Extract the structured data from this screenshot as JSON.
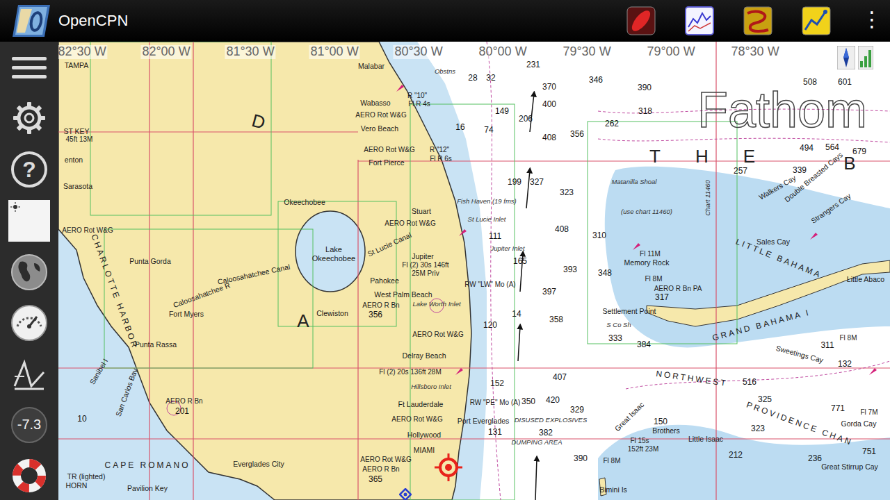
{
  "window": {
    "title": "OpenCPN",
    "menu_glyph": "⋮"
  },
  "sidebar": {
    "help_glyph": "?",
    "zoom_reading": "-7.3"
  },
  "map": {
    "longitudes": [
      "82°30 W",
      "82°00 W",
      "81°30 W",
      "81°00 W",
      "80°30 W",
      "80°00 W",
      "79°30 W",
      "79°00 W",
      "78°30 W"
    ],
    "labels": [
      {
        "text": "TAMPA",
        "kind": "place"
      },
      {
        "text": "ST KEY",
        "kind": "place"
      },
      {
        "text": "45ft 13M",
        "kind": "light"
      },
      {
        "text": "enton",
        "kind": "place"
      },
      {
        "text": "Sarasota",
        "kind": "place"
      },
      {
        "text": "AERO Rot W&G",
        "kind": "nav"
      },
      {
        "text": "CHARLOTTE HARBOR",
        "kind": "caps"
      },
      {
        "text": "Punta Gorda",
        "kind": "place"
      },
      {
        "text": "Caloosahatchee R",
        "kind": "place"
      },
      {
        "text": "Caloosahatchee Canal",
        "kind": "place"
      },
      {
        "text": "Fort Myers",
        "kind": "place"
      },
      {
        "text": "Punta Rassa",
        "kind": "place"
      },
      {
        "text": "Sanibel I",
        "kind": "place"
      },
      {
        "text": "San Carlos Bay",
        "kind": "place"
      },
      {
        "text": "AERO R Bn",
        "kind": "nav"
      },
      {
        "text": "201",
        "kind": "depth"
      },
      {
        "text": "10",
        "kind": "depth"
      },
      {
        "text": "CAPE ROMANO",
        "kind": "caps"
      },
      {
        "text": "Everglades City",
        "kind": "place"
      },
      {
        "text": "TR (lighted)",
        "kind": "place"
      },
      {
        "text": "HORN",
        "kind": "place"
      },
      {
        "text": "Pavilion Key",
        "kind": "place"
      },
      {
        "text": "D",
        "kind": "big"
      },
      {
        "text": "A",
        "kind": "big"
      },
      {
        "text": "Malabar",
        "kind": "place"
      },
      {
        "text": "Wabasso",
        "kind": "place"
      },
      {
        "text": "AERO Rot W&G",
        "kind": "nav"
      },
      {
        "text": "Vero Beach",
        "kind": "place"
      },
      {
        "text": "AERO Rot W&G",
        "kind": "nav"
      },
      {
        "text": "Fort Pierce",
        "kind": "place"
      },
      {
        "text": "R \"10\"",
        "kind": "light"
      },
      {
        "text": "Fl R 4s",
        "kind": "light"
      },
      {
        "text": "R \"12\"",
        "kind": "light"
      },
      {
        "text": "Fl R 6s",
        "kind": "light"
      },
      {
        "text": "Okeechobee",
        "kind": "place"
      },
      {
        "text": "Lake Okeechobee",
        "kind": "lake"
      },
      {
        "text": "St Lucie Canal",
        "kind": "place"
      },
      {
        "text": "Stuart",
        "kind": "place"
      },
      {
        "text": "AERO Rot W&G",
        "kind": "nav"
      },
      {
        "text": "Jupiter",
        "kind": "place"
      },
      {
        "text": "Fl (2) 30s 146ft",
        "kind": "light"
      },
      {
        "text": "25M Priv",
        "kind": "light"
      },
      {
        "text": "Pahokee",
        "kind": "place"
      },
      {
        "text": "Clewiston",
        "kind": "place"
      },
      {
        "text": "West Palm Beach",
        "kind": "place"
      },
      {
        "text": "Lake Worth Inlet",
        "kind": "area"
      },
      {
        "text": "AERO R Bn",
        "kind": "nav"
      },
      {
        "text": "356",
        "kind": "depth"
      },
      {
        "text": "AERO Rot W&G",
        "kind": "nav"
      },
      {
        "text": "Delray Beach",
        "kind": "place"
      },
      {
        "text": "Fl (2) 20s 136ft 28M",
        "kind": "light"
      },
      {
        "text": "Hillsboro Inlet",
        "kind": "area"
      },
      {
        "text": "Ft Lauderdale",
        "kind": "place"
      },
      {
        "text": "AERO Rot W&G",
        "kind": "nav"
      },
      {
        "text": "Hollywood",
        "kind": "place"
      },
      {
        "text": "AERO Rot W&G",
        "kind": "nav"
      },
      {
        "text": "AERO R Bn",
        "kind": "nav"
      },
      {
        "text": "365",
        "kind": "depth"
      },
      {
        "text": "MIAMI",
        "kind": "place"
      },
      {
        "text": "Port Everglades",
        "kind": "place"
      },
      {
        "text": "RW \"PE\" Mo (A)",
        "kind": "light"
      },
      {
        "text": "RW \"LW\" Mo (A)",
        "kind": "light"
      },
      {
        "text": "Fish Haven (19 fms)",
        "kind": "area"
      },
      {
        "text": "St Lucie Inlet",
        "kind": "area"
      },
      {
        "text": "Jupiter Inlet",
        "kind": "area"
      },
      {
        "text": "Obstns",
        "kind": "area"
      },
      {
        "text": "DISUSED EXPLOSIVES",
        "kind": "area"
      },
      {
        "text": "DUMPING AREA",
        "kind": "area"
      },
      {
        "text": "28",
        "kind": "depth"
      },
      {
        "text": "32",
        "kind": "depth"
      },
      {
        "text": "231",
        "kind": "depth"
      },
      {
        "text": "370",
        "kind": "depth"
      },
      {
        "text": "346",
        "kind": "depth"
      },
      {
        "text": "390",
        "kind": "depth"
      },
      {
        "text": "149",
        "kind": "depth"
      },
      {
        "text": "206",
        "kind": "depth"
      },
      {
        "text": "400",
        "kind": "depth"
      },
      {
        "text": "16",
        "kind": "depth"
      },
      {
        "text": "74",
        "kind": "depth"
      },
      {
        "text": "356",
        "kind": "depth"
      },
      {
        "text": "408",
        "kind": "depth"
      },
      {
        "text": "318",
        "kind": "depth"
      },
      {
        "text": "262",
        "kind": "depth"
      },
      {
        "text": "508",
        "kind": "depth"
      },
      {
        "text": "601",
        "kind": "depth"
      },
      {
        "text": "494",
        "kind": "depth"
      },
      {
        "text": "564",
        "kind": "depth"
      },
      {
        "text": "679",
        "kind": "depth"
      },
      {
        "text": "199",
        "kind": "depth"
      },
      {
        "text": "327",
        "kind": "depth"
      },
      {
        "text": "323",
        "kind": "depth"
      },
      {
        "text": "257",
        "kind": "depth"
      },
      {
        "text": "339",
        "kind": "depth"
      },
      {
        "text": "408",
        "kind": "depth"
      },
      {
        "text": "310",
        "kind": "depth"
      },
      {
        "text": "111",
        "kind": "depth"
      },
      {
        "text": "165",
        "kind": "depth"
      },
      {
        "text": "393",
        "kind": "depth"
      },
      {
        "text": "348",
        "kind": "depth"
      },
      {
        "text": "397",
        "kind": "depth"
      },
      {
        "text": "358",
        "kind": "depth"
      },
      {
        "text": "14",
        "kind": "depth"
      },
      {
        "text": "120",
        "kind": "depth"
      },
      {
        "text": "333",
        "kind": "depth"
      },
      {
        "text": "384",
        "kind": "depth"
      },
      {
        "text": "516",
        "kind": "depth"
      },
      {
        "text": "325",
        "kind": "depth"
      },
      {
        "text": "323",
        "kind": "depth"
      },
      {
        "text": "771",
        "kind": "depth"
      },
      {
        "text": "751",
        "kind": "depth"
      },
      {
        "text": "311",
        "kind": "depth"
      },
      {
        "text": "132",
        "kind": "depth"
      },
      {
        "text": "212",
        "kind": "depth"
      },
      {
        "text": "236",
        "kind": "depth"
      },
      {
        "text": "150",
        "kind": "depth"
      },
      {
        "text": "350",
        "kind": "depth"
      },
      {
        "text": "420",
        "kind": "depth"
      },
      {
        "text": "329",
        "kind": "depth"
      },
      {
        "text": "382",
        "kind": "depth"
      },
      {
        "text": "390",
        "kind": "depth"
      },
      {
        "text": "131",
        "kind": "depth"
      },
      {
        "text": "152",
        "kind": "depth"
      },
      {
        "text": "407",
        "kind": "depth"
      },
      {
        "text": "Fathom",
        "kind": "watermark"
      },
      {
        "text": "THE",
        "kind": "spaced"
      },
      {
        "text": "B",
        "kind": "big"
      },
      {
        "text": "Matanilla Shoal",
        "kind": "area"
      },
      {
        "text": "(use chart 11460)",
        "kind": "area"
      },
      {
        "text": "Chart 11460",
        "kind": "area"
      },
      {
        "text": "Walkers Cay",
        "kind": "place"
      },
      {
        "text": "Double Breasted Cays",
        "kind": "place"
      },
      {
        "text": "Strangers Cay",
        "kind": "place"
      },
      {
        "text": "Sales Cay",
        "kind": "place"
      },
      {
        "text": "LITTLE BAHAMA",
        "kind": "caps"
      },
      {
        "text": "Little Abaco",
        "kind": "place"
      },
      {
        "text": "Fl 11M",
        "kind": "light"
      },
      {
        "text": "Memory Rock",
        "kind": "place"
      },
      {
        "text": "Fl 8M",
        "kind": "light"
      },
      {
        "text": "AERO R Bn PA",
        "kind": "nav"
      },
      {
        "text": "317",
        "kind": "depth"
      },
      {
        "text": "Settlement Point",
        "kind": "place"
      },
      {
        "text": "S Co Sh",
        "kind": "area"
      },
      {
        "text": "GRAND BAHAMA I",
        "kind": "caps"
      },
      {
        "text": "Sweetings Cay",
        "kind": "place"
      },
      {
        "text": "NORTHWEST",
        "kind": "caps"
      },
      {
        "text": "PROVIDENCE CHAN",
        "kind": "caps"
      },
      {
        "text": "Great Isaac",
        "kind": "place"
      },
      {
        "text": "Brothers",
        "kind": "place"
      },
      {
        "text": "Little Isaac",
        "kind": "place"
      },
      {
        "text": "Fl 15s",
        "kind": "light"
      },
      {
        "text": "152ft 23M",
        "kind": "light"
      },
      {
        "text": "Fl 8M",
        "kind": "light"
      },
      {
        "text": "Bimini Is",
        "kind": "place"
      },
      {
        "text": "Gorda Cay",
        "kind": "place"
      },
      {
        "text": "Great Stirrup Cay",
        "kind": "place"
      },
      {
        "text": "Fl 7M",
        "kind": "light"
      },
      {
        "text": "Fl 8M",
        "kind": "light"
      }
    ]
  }
}
